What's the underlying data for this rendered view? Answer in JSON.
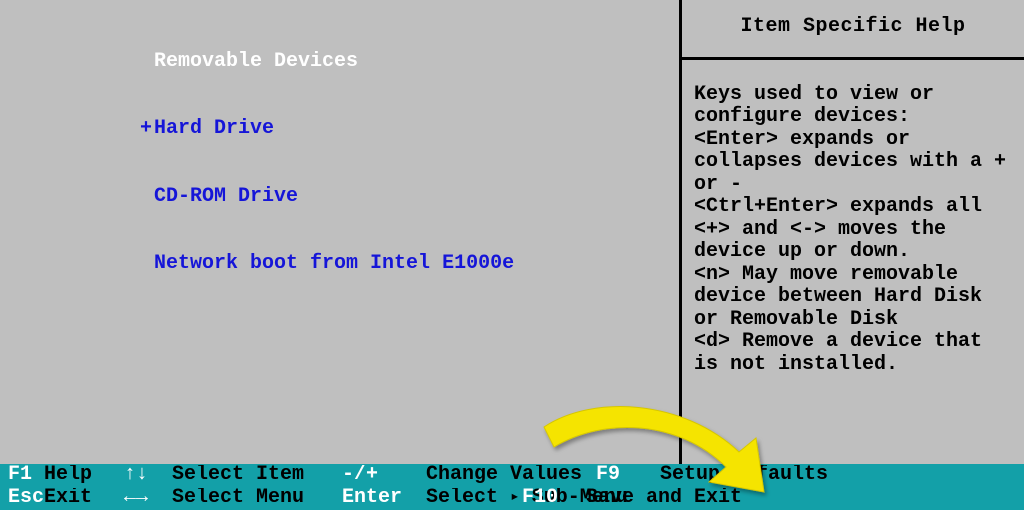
{
  "boot_list": {
    "items": [
      {
        "label": "Removable Devices",
        "marker": "",
        "selected": true
      },
      {
        "label": "Hard Drive",
        "marker": "+",
        "selected": false
      },
      {
        "label": "CD-ROM Drive",
        "marker": "",
        "selected": false
      },
      {
        "label": "Network boot from Intel E1000e",
        "marker": "",
        "selected": false
      }
    ]
  },
  "help": {
    "title": "Item Specific Help",
    "body": "Keys used to view or configure devices:\n<Enter> expands or collapses devices with a + or -\n<Ctrl+Enter> expands all\n<+> and <-> moves the device up or down.\n<n> May move removable device between Hard Disk or Removable Disk\n<d> Remove a device that is not installed."
  },
  "footer": {
    "row1": {
      "k1": "F1",
      "l1": "Help",
      "k2": "↑↓",
      "l2": "Select Item",
      "k3": "-/+",
      "l3": "Change Values",
      "k4": "F9",
      "l4": "Setup Defaults"
    },
    "row2": {
      "k1": "Esc",
      "l1": "Exit",
      "k2": "←→",
      "l2": "Select Menu",
      "k3": "Enter",
      "l3a": "Select",
      "tri": "▸",
      "l3b": "Sub-Menu",
      "k4": "F10",
      "l4": "Save and Exit"
    }
  }
}
